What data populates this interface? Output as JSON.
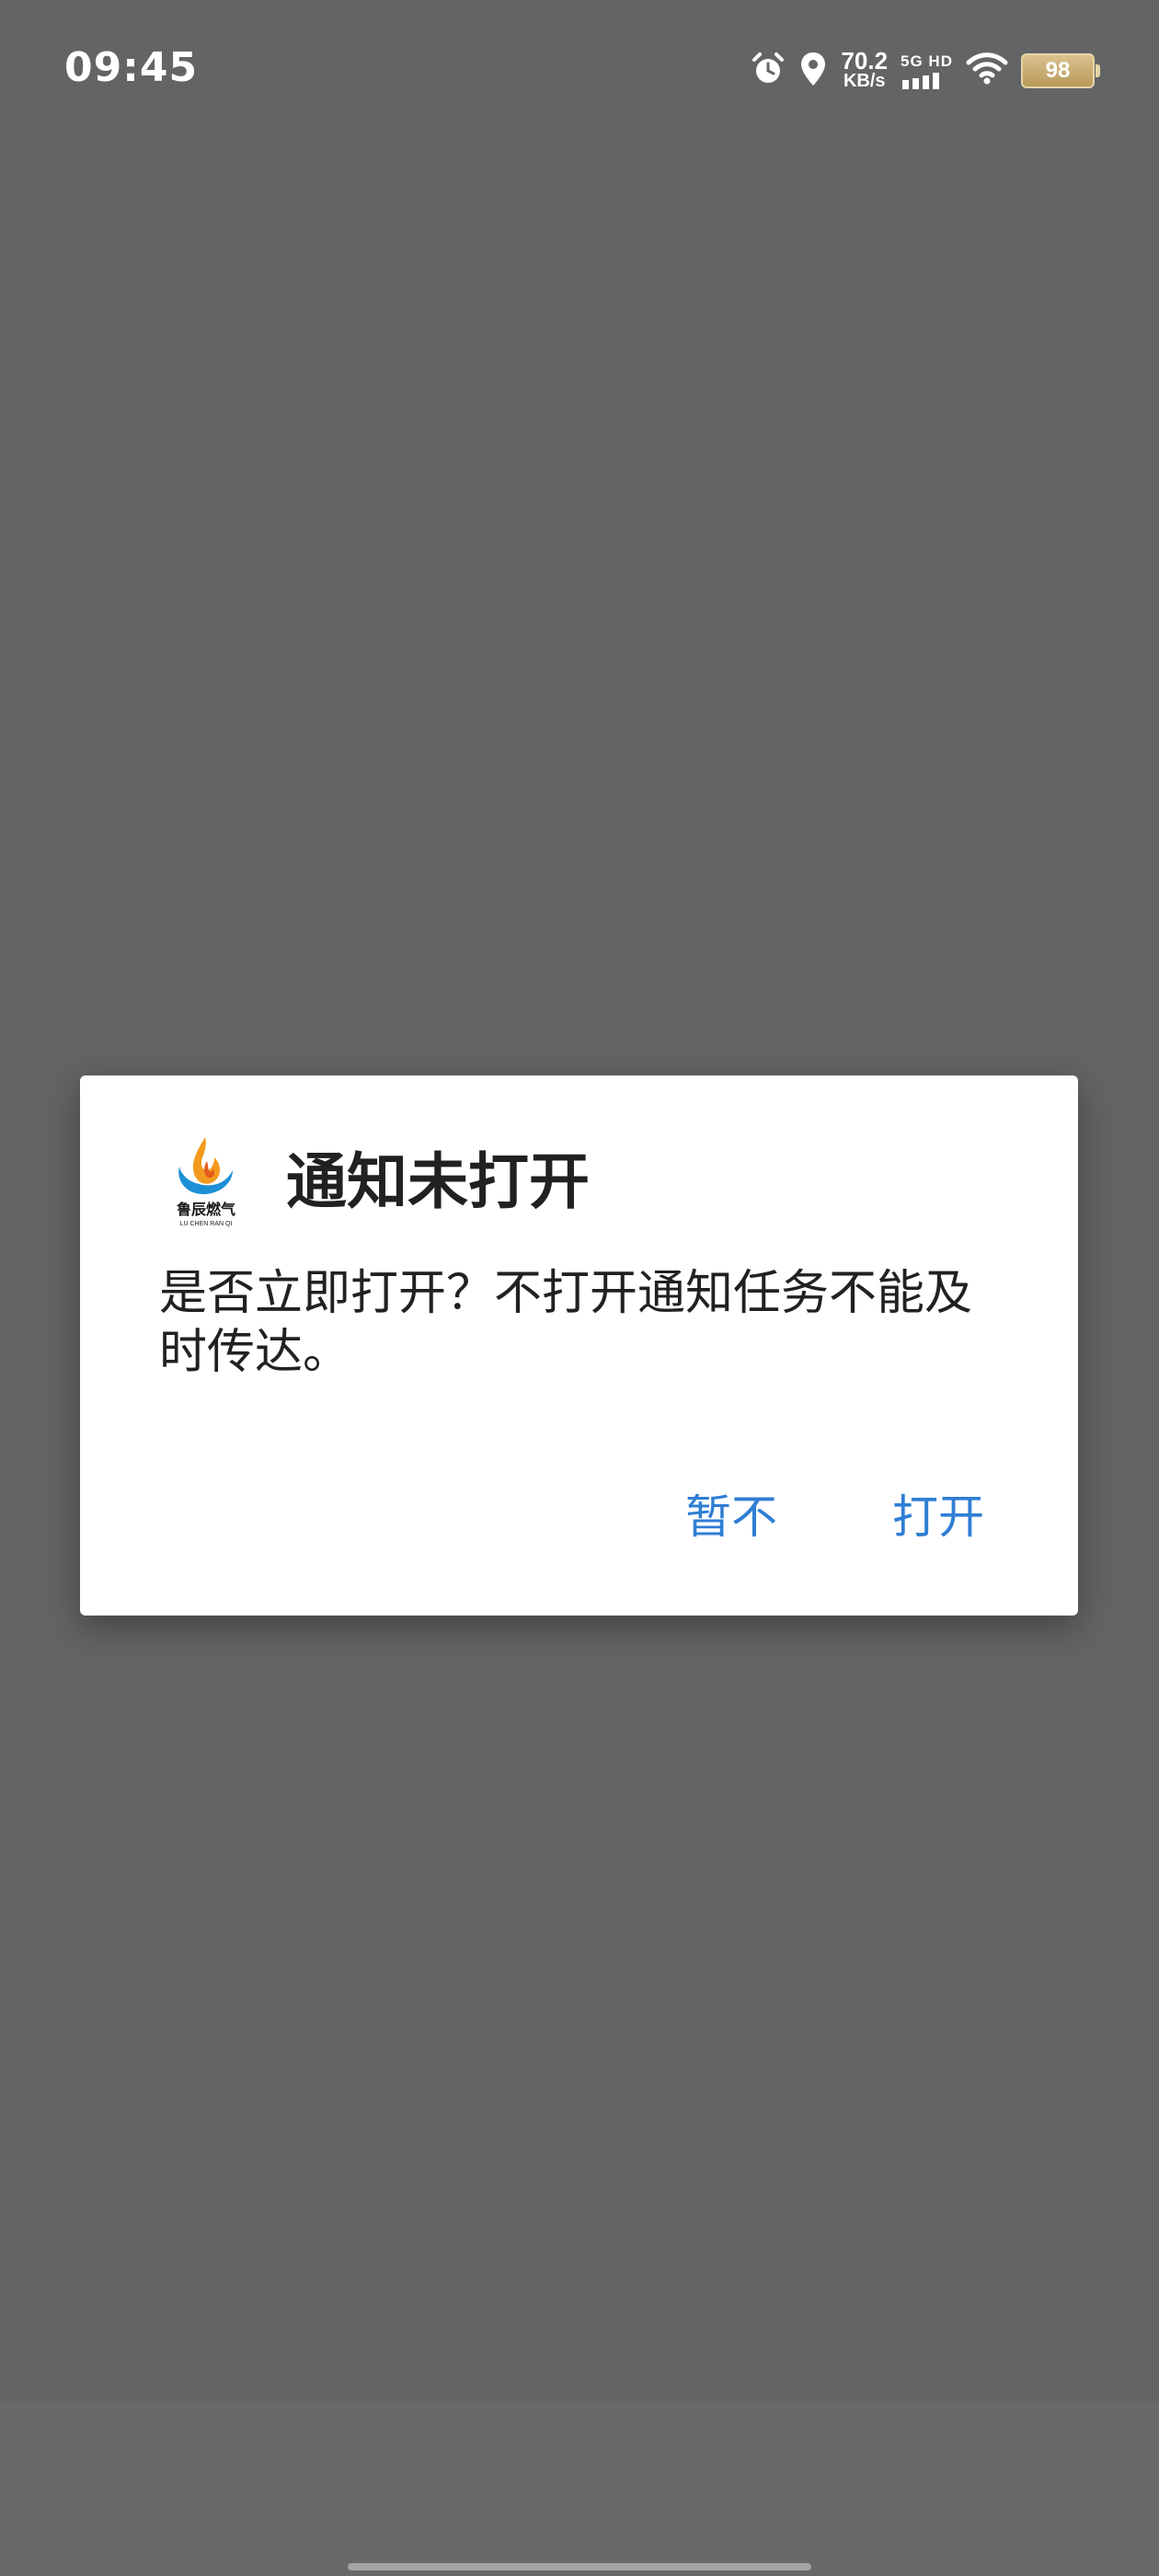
{
  "status_bar": {
    "time": "09:45",
    "net_speed_value": "70.2",
    "net_speed_unit": "KB/s",
    "signal_label": "5G HD",
    "battery_level": "98",
    "icons": [
      "alarm-icon",
      "location-icon",
      "cellular-signal-icon",
      "wifi-icon",
      "battery-icon"
    ]
  },
  "dialog": {
    "logo_icon": "lu-chen-gas-logo",
    "logo_text": "鲁辰燃气",
    "logo_subtext": "LU CHEN RAN QI",
    "title": "通知未打开",
    "message": "是否立即打开？不打开通知任务不能及时传达。",
    "cancel_label": "暂不",
    "confirm_label": "打开"
  },
  "colors": {
    "overlay": "#636466",
    "dialog_bg": "#ffffff",
    "accent": "#2f7ed4",
    "text": "#212121",
    "nav_bg": "#696969"
  }
}
